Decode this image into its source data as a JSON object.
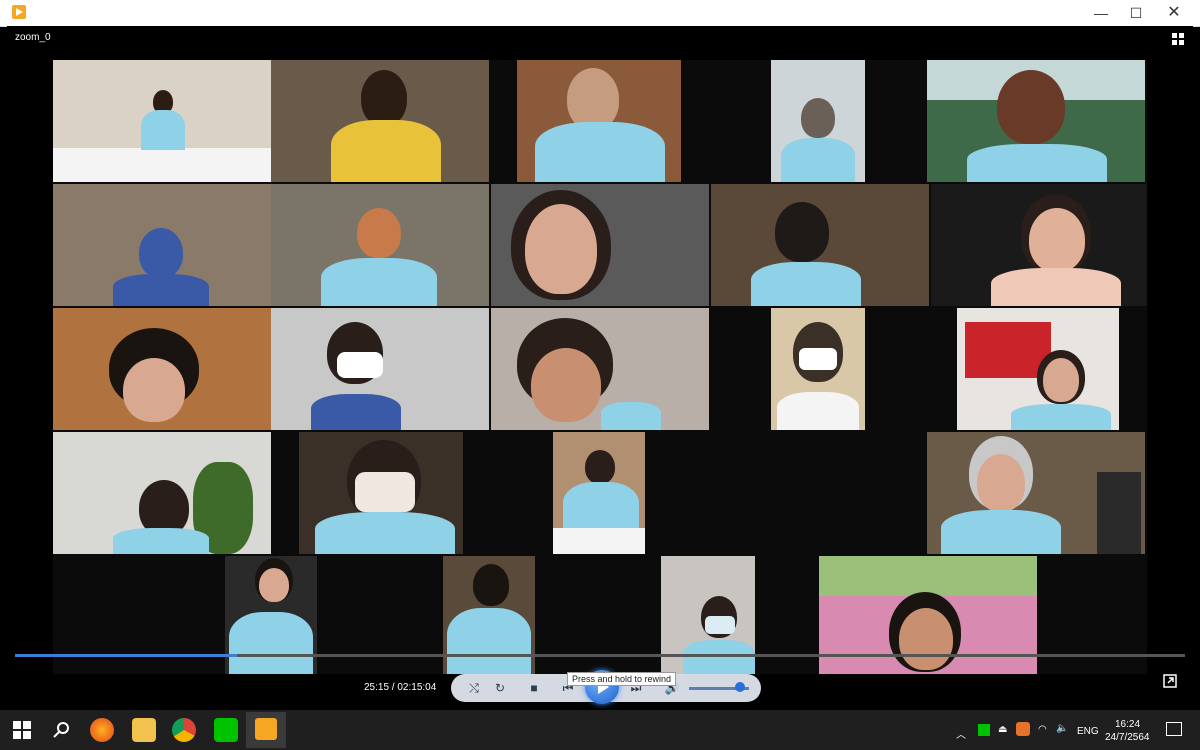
{
  "window": {
    "title": "",
    "minimize_label": "—",
    "maximize_label": "☐",
    "close_label": "✕"
  },
  "player": {
    "video_title": "zoom_0",
    "time_current": "25:15",
    "time_total": "02:15:04",
    "time_readout": "25:15 / 02:15:04",
    "seek_progress": 0.19,
    "tooltip": "Press and hold to rewind",
    "volume_level": 0.85
  },
  "taskbar": {
    "language": "ENG",
    "time": "16:24",
    "date": "24/7/2564"
  },
  "colors": {
    "accent": "#3f7dd6",
    "tile_bg": "#3a3a3a",
    "shirt": "#8fd1e6"
  },
  "icons": {
    "start": "windows-logo-icon",
    "search": "search-icon",
    "firefox": "firefox-icon",
    "explorer": "file-explorer-icon",
    "chrome": "chrome-icon",
    "line": "line-app-icon",
    "player": "media-player-icon"
  }
}
